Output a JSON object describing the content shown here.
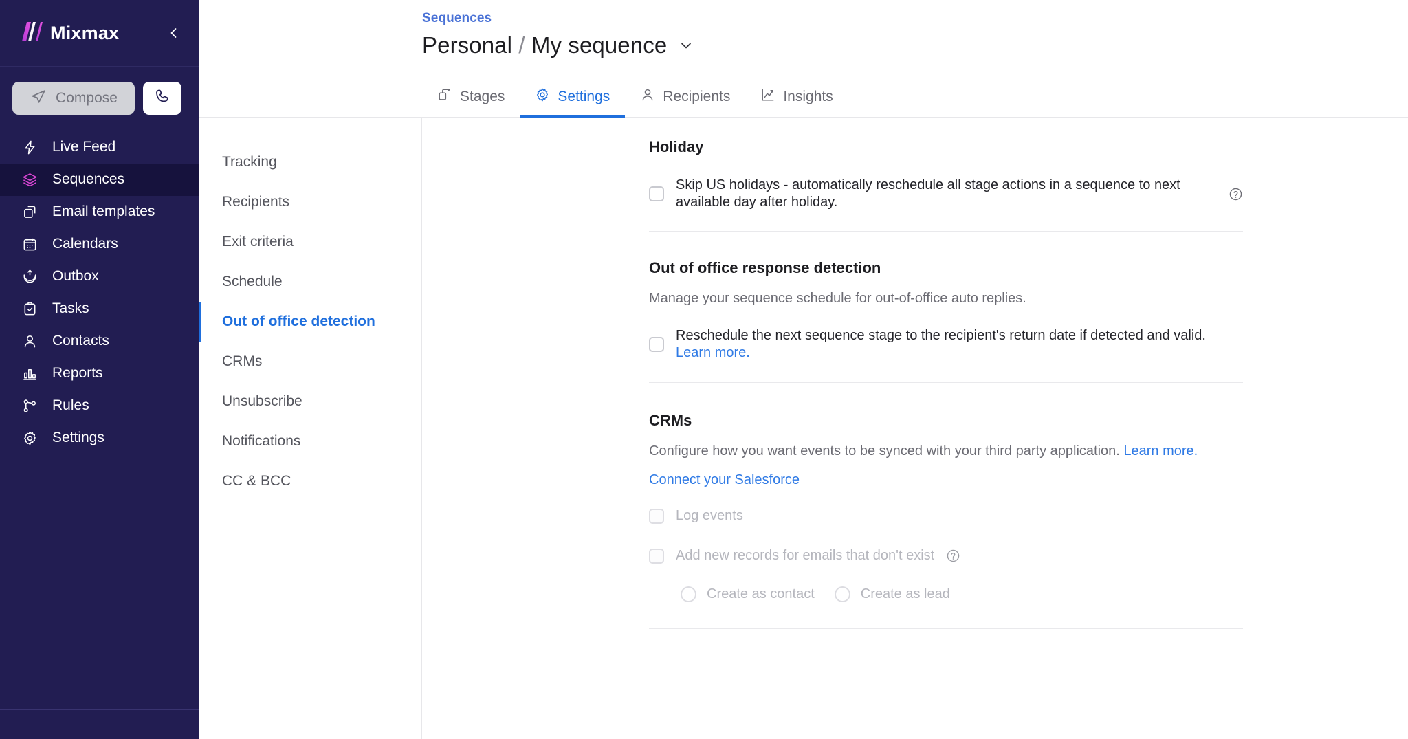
{
  "sidebar": {
    "brand": "Mixmax",
    "collapse_icon": "chevron-left-icon",
    "compose": {
      "label": "Compose",
      "icon": "paper-plane-icon"
    },
    "dialer": {
      "icon": "phone-icon"
    },
    "items": [
      {
        "label": "Live Feed",
        "icon": "bolt-icon",
        "active": false
      },
      {
        "label": "Sequences",
        "icon": "layers-icon",
        "active": true
      },
      {
        "label": "Email templates",
        "icon": "copy-icon",
        "active": false
      },
      {
        "label": "Calendars",
        "icon": "calendar-icon",
        "active": false
      },
      {
        "label": "Outbox",
        "icon": "outbox-icon",
        "active": false
      },
      {
        "label": "Tasks",
        "icon": "clipboard-check-icon",
        "active": false
      },
      {
        "label": "Contacts",
        "icon": "person-icon",
        "active": false
      },
      {
        "label": "Reports",
        "icon": "bar-chart-icon",
        "active": false
      },
      {
        "label": "Rules",
        "icon": "branch-icon",
        "active": false
      },
      {
        "label": "Settings",
        "icon": "gear-icon",
        "active": false
      }
    ]
  },
  "header": {
    "breadcrumb": "Sequences",
    "title_owner": "Personal",
    "title_separator": "/",
    "title_name": "My sequence",
    "title_caret_icon": "chevron-down-icon"
  },
  "tabs": [
    {
      "label": "Stages",
      "icon": "stages-icon",
      "active": false
    },
    {
      "label": "Settings",
      "icon": "gear-icon",
      "active": true
    },
    {
      "label": "Recipients",
      "icon": "person-icon",
      "active": false
    },
    {
      "label": "Insights",
      "icon": "line-chart-icon",
      "active": false
    }
  ],
  "settings_nav": [
    {
      "label": "Tracking",
      "active": false
    },
    {
      "label": "Recipients",
      "active": false
    },
    {
      "label": "Exit criteria",
      "active": false
    },
    {
      "label": "Schedule",
      "active": false
    },
    {
      "label": "Out of office detection",
      "active": true
    },
    {
      "label": "CRMs",
      "active": false
    },
    {
      "label": "Unsubscribe",
      "active": false
    },
    {
      "label": "Notifications",
      "active": false
    },
    {
      "label": "CC & BCC",
      "active": false
    }
  ],
  "sections": {
    "holiday": {
      "title": "Holiday",
      "checkbox_label": "Skip US holidays - automatically reschedule all stage actions in a sequence to next available day after holiday.",
      "help_icon": "question-circle-icon",
      "checked": false
    },
    "ooo": {
      "title": "Out of office response detection",
      "description": "Manage your sequence schedule for out-of-office auto replies.",
      "checkbox_label": "Reschedule the next sequence stage to the recipient's return date if detected and valid.",
      "learn_more": "Learn more.",
      "checked": false
    },
    "crms": {
      "title": "CRMs",
      "description": "Configure how you want events to be synced with your third party application.",
      "learn_more": "Learn more.",
      "connect_link": "Connect your Salesforce",
      "log_events_label": "Log events",
      "log_events_checked": false,
      "add_records_label": "Add new records for emails that don't exist",
      "add_records_help_icon": "question-circle-icon",
      "add_records_checked": false,
      "radios": [
        {
          "label": "Create as contact",
          "selected": false
        },
        {
          "label": "Create as lead",
          "selected": false
        }
      ]
    }
  },
  "colors": {
    "sidebar_bg": "#221d52",
    "sidebar_active": "#16123d",
    "accent_blue": "#1f6fdd",
    "link_blue": "#2f7ae5",
    "brand_pink": "#d946d4"
  }
}
